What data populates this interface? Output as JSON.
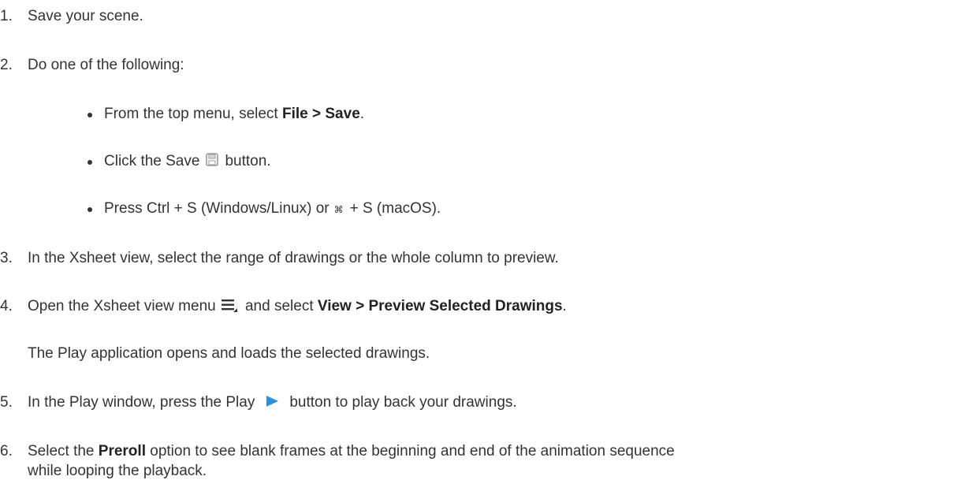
{
  "steps": [
    {
      "num": "1.",
      "text": "Save your scene."
    },
    {
      "num": "2.",
      "text": "Do one of the following:"
    },
    {
      "num": "3.",
      "text": "In the Xsheet view, select the range of drawings or the whole column to preview."
    },
    {
      "num": "4.",
      "text_before": "Open the Xsheet view menu",
      "text_mid": " and select ",
      "bold": "View > Preview Selected Drawings",
      "text_after": "."
    },
    {
      "num": "5.",
      "text_before": "In the Play window, press the Play",
      "text_after": "button to play back your drawings."
    },
    {
      "num": "6.",
      "text_before": "Select the ",
      "bold": "Preroll",
      "text_after": " option to see blank frames at the beginning and end of the animation sequence",
      "text_line2": "while looping the playback."
    }
  ],
  "substeps": [
    {
      "text_before": "From the top menu, select ",
      "bold": "File > Save",
      "text_after": "."
    },
    {
      "text_before": "Click the Save",
      "text_after": "button."
    },
    {
      "text_before": "Press Ctrl + S (Windows/Linux) or",
      "cmd_symbol": "⌘",
      "text_after": "+ S (macOS)."
    }
  ],
  "step4_note": "The Play application opens and loads the selected drawings.",
  "icons": {
    "save": "save-icon",
    "menu": "hamburger-menu-icon",
    "play": "play-icon"
  },
  "colors": {
    "text": "#333333",
    "play_icon": "#2d8fd8",
    "save_icon": "#9a9a9a"
  }
}
